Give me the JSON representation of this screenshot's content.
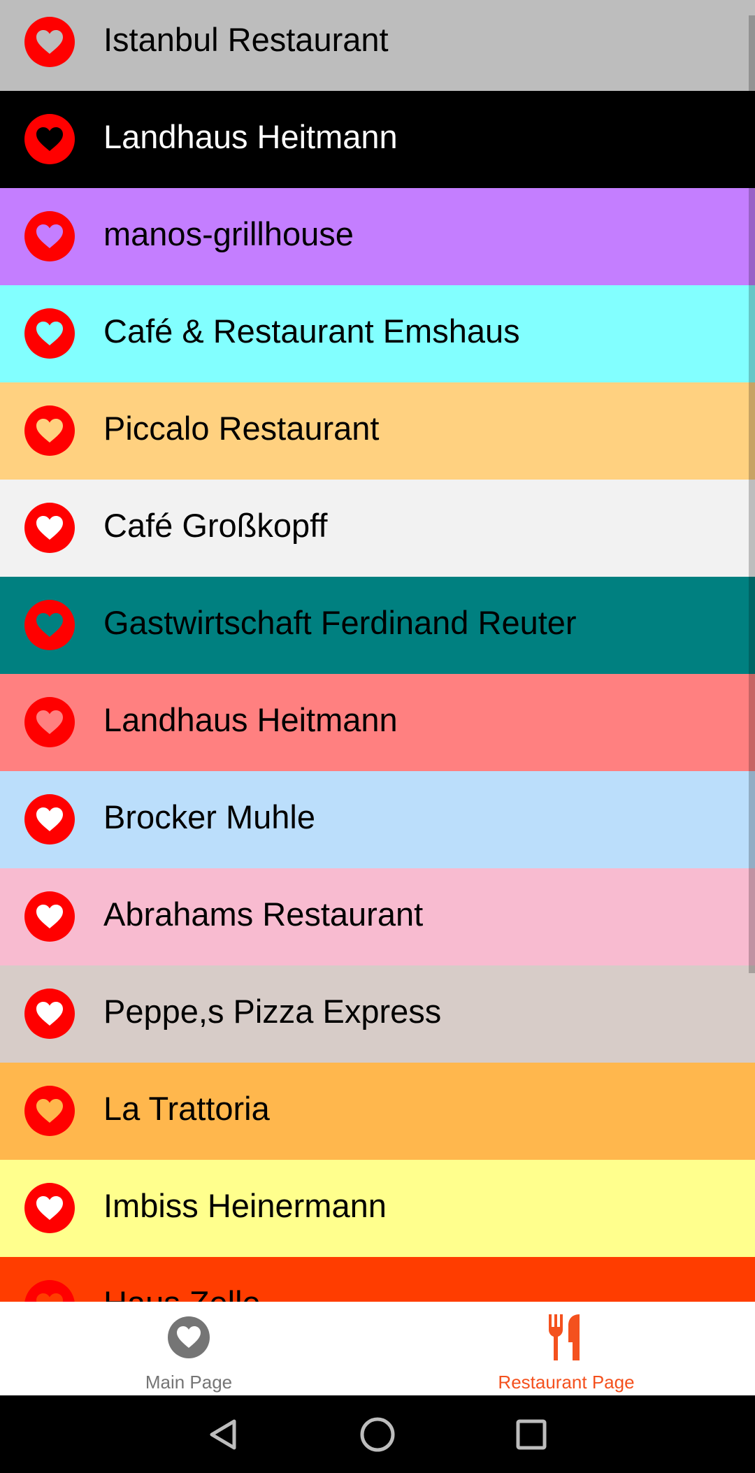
{
  "restaurants": [
    {
      "name": "Istanbul Restaurant",
      "bg": "#bdbdbd",
      "heart": "#bdbdbd",
      "text": "#000000"
    },
    {
      "name": "Landhaus Heitmann",
      "bg": "#000000",
      "heart": "#000000",
      "text": "#ffffff"
    },
    {
      "name": "manos-grillhouse",
      "bg": "#c47eff",
      "heart": "#c47eff",
      "text": "#000000"
    },
    {
      "name": "Café & Restaurant Emshaus",
      "bg": "#82ffff",
      "heart": "#82ffff",
      "text": "#000000"
    },
    {
      "name": "Piccalo Restaurant",
      "bg": "#ffd180",
      "heart": "#ffd180",
      "text": "#000000"
    },
    {
      "name": "Café Großkopff",
      "bg": "#f2f2f2",
      "heart": "#ffffff",
      "text": "#000000"
    },
    {
      "name": "Gastwirtschaft Ferdinand Reuter",
      "bg": "#008080",
      "heart": "#008080",
      "text": "#000000"
    },
    {
      "name": "Landhaus Heitmann",
      "bg": "#ff8080",
      "heart": "#ff8080",
      "text": "#000000"
    },
    {
      "name": "Brocker Muhle",
      "bg": "#bbdefb",
      "heart": "#ffffff",
      "text": "#000000"
    },
    {
      "name": "Abrahams Restaurant",
      "bg": "#f8bbd0",
      "heart": "#ffffff",
      "text": "#000000"
    },
    {
      "name": "Peppe,s Pizza Express",
      "bg": "#d7ccc8",
      "heart": "#ffffff",
      "text": "#000000"
    },
    {
      "name": "La Trattoria",
      "bg": "#ffb74d",
      "heart": "#ffb74d",
      "text": "#000000"
    },
    {
      "name": "Imbiss Heinermann",
      "bg": "#ffff8d",
      "heart": "#ffffff",
      "text": "#000000"
    },
    {
      "name": "Haus Zelle",
      "bg": "#ff3d00",
      "heart": "#ff3d00",
      "text": "#000000"
    }
  ],
  "favorite_icon": "heart-icon",
  "bottom_nav": {
    "items": [
      {
        "label": "Main Page",
        "icon": "heart-circle-icon",
        "color": "#757575",
        "active": false
      },
      {
        "label": "Restaurant Page",
        "icon": "restaurant-icon",
        "color": "#f4511e",
        "active": true
      }
    ]
  },
  "system_nav": {
    "back": "back-icon",
    "home": "home-icon",
    "recents": "recents-icon"
  }
}
